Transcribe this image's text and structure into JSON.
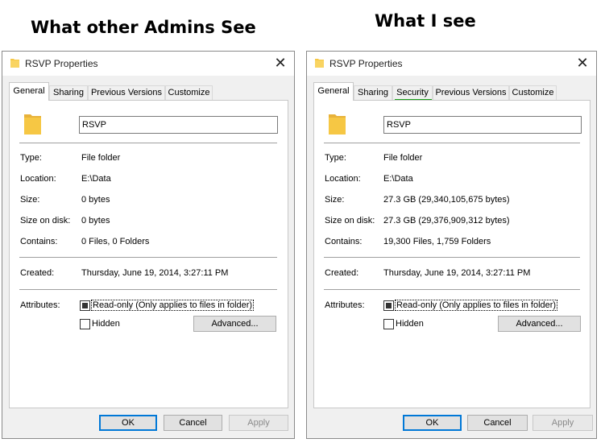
{
  "left_heading": "What other Admins See",
  "right_heading": "What I see",
  "left_window": {
    "title": "RSVP Properties",
    "tabs": [
      "General",
      "Sharing",
      "Previous Versions",
      "Customize"
    ],
    "folder_name": "RSVP",
    "labels": {
      "type": "Type:",
      "location": "Location:",
      "size": "Size:",
      "size_on_disk": "Size on disk:",
      "contains": "Contains:",
      "created": "Created:",
      "attributes": "Attributes:"
    },
    "values": {
      "type": "File folder",
      "location": "E:\\Data",
      "size": "0 bytes",
      "size_on_disk": "0 bytes",
      "contains": "0 Files, 0 Folders",
      "created": "Thursday, June 19, 2014, 3:27:11 PM"
    },
    "readonly_label": "Read-only (Only applies to files in folder)",
    "hidden_label": "Hidden",
    "advanced_label": "Advanced...",
    "ok_label": "OK",
    "cancel_label": "Cancel",
    "apply_label": "Apply"
  },
  "right_window": {
    "title": "RSVP Properties",
    "tabs": [
      "General",
      "Sharing",
      "Security",
      "Previous Versions",
      "Customize"
    ],
    "folder_name": "RSVP",
    "labels": {
      "type": "Type:",
      "location": "Location:",
      "size": "Size:",
      "size_on_disk": "Size on disk:",
      "contains": "Contains:",
      "created": "Created:",
      "attributes": "Attributes:"
    },
    "values": {
      "type": "File folder",
      "location": "E:\\Data",
      "size": "27.3 GB (29,340,105,675 bytes)",
      "size_on_disk": "27.3 GB (29,376,909,312 bytes)",
      "contains": "19,300 Files, 1,759 Folders",
      "created": "Thursday, June 19, 2014, 3:27:11 PM"
    },
    "readonly_label": "Read-only (Only applies to files in folder)",
    "hidden_label": "Hidden",
    "advanced_label": "Advanced...",
    "ok_label": "OK",
    "cancel_label": "Cancel",
    "apply_label": "Apply"
  },
  "colors": {
    "highlight_underline": "#1aa01a",
    "default_button_border": "#0078d7",
    "folder_yellow": "#f6c744"
  }
}
